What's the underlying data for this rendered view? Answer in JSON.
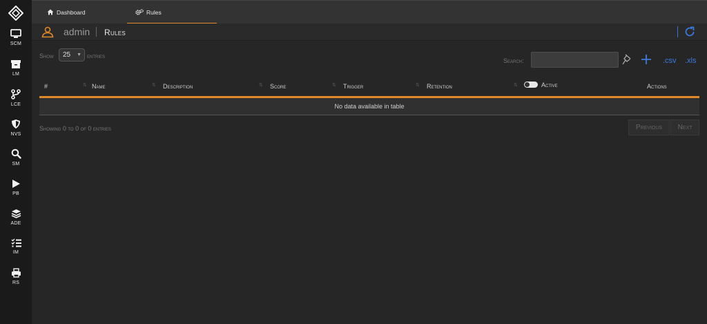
{
  "sidebar": {
    "logo_icon": "diamond-logo-icon",
    "items": [
      {
        "label": "SCM",
        "icon": "monitor-icon"
      },
      {
        "label": "LM",
        "icon": "archive-icon"
      },
      {
        "label": "LCE",
        "icon": "branch-icon"
      },
      {
        "label": "NVS",
        "icon": "shield-icon"
      },
      {
        "label": "SM",
        "icon": "search-icon"
      },
      {
        "label": "PB",
        "icon": "play-icon"
      },
      {
        "label": "ADE",
        "icon": "layers-icon"
      },
      {
        "label": "IM",
        "icon": "checklist-icon"
      },
      {
        "label": "RS",
        "icon": "printer-icon"
      }
    ]
  },
  "tabs": [
    {
      "label": "Dashboard",
      "icon": "home-icon"
    },
    {
      "label": "Rules",
      "icon": "cogs-icon",
      "active": true
    }
  ],
  "header": {
    "user": "admin",
    "title": "Rules",
    "user_icon": "user-icon",
    "refresh_icon": "refresh-icon"
  },
  "controls": {
    "show_label": "Show",
    "page_size": "25",
    "entries_label": "entries",
    "search_label": "Search:",
    "search_value": "",
    "csv_label": ".csv",
    "xls_label": ".xls",
    "pin_icon": "pin-icon",
    "add_icon": "plus-icon"
  },
  "table": {
    "columns": [
      "#",
      "Name",
      "Description",
      "Score",
      "Trigger",
      "Retention",
      "Active",
      "Actions"
    ],
    "empty_message": "No data available in table",
    "active_toggle_on": false
  },
  "footer": {
    "showing": "Showing 0 to 0 of 0 entries",
    "previous": "Previous",
    "next": "Next"
  },
  "colors": {
    "accent": "#e0892a",
    "link": "#3d7be0",
    "background": "#262626",
    "sidebar": "#1a1a1a"
  }
}
